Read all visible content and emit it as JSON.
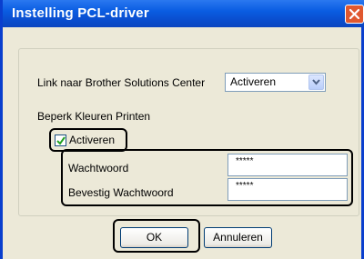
{
  "window": {
    "title": "Instelling PCL-driver"
  },
  "link_row": {
    "label": "Link naar Brother Solutions Center",
    "selected": "Activeren"
  },
  "restrict": {
    "section_label": "Beperk Kleuren Printen",
    "checkbox_label": "Activeren",
    "checked": true,
    "password_label": "Wachtwoord",
    "password_value": "*****",
    "confirm_label": "Bevestig Wachtwoord",
    "confirm_value": "*****"
  },
  "buttons": {
    "ok": "OK",
    "cancel": "Annuleren"
  },
  "colors": {
    "titlebar": "#0a5de2",
    "close_button": "#e0582f",
    "dialog_bg": "#ece9d8"
  }
}
